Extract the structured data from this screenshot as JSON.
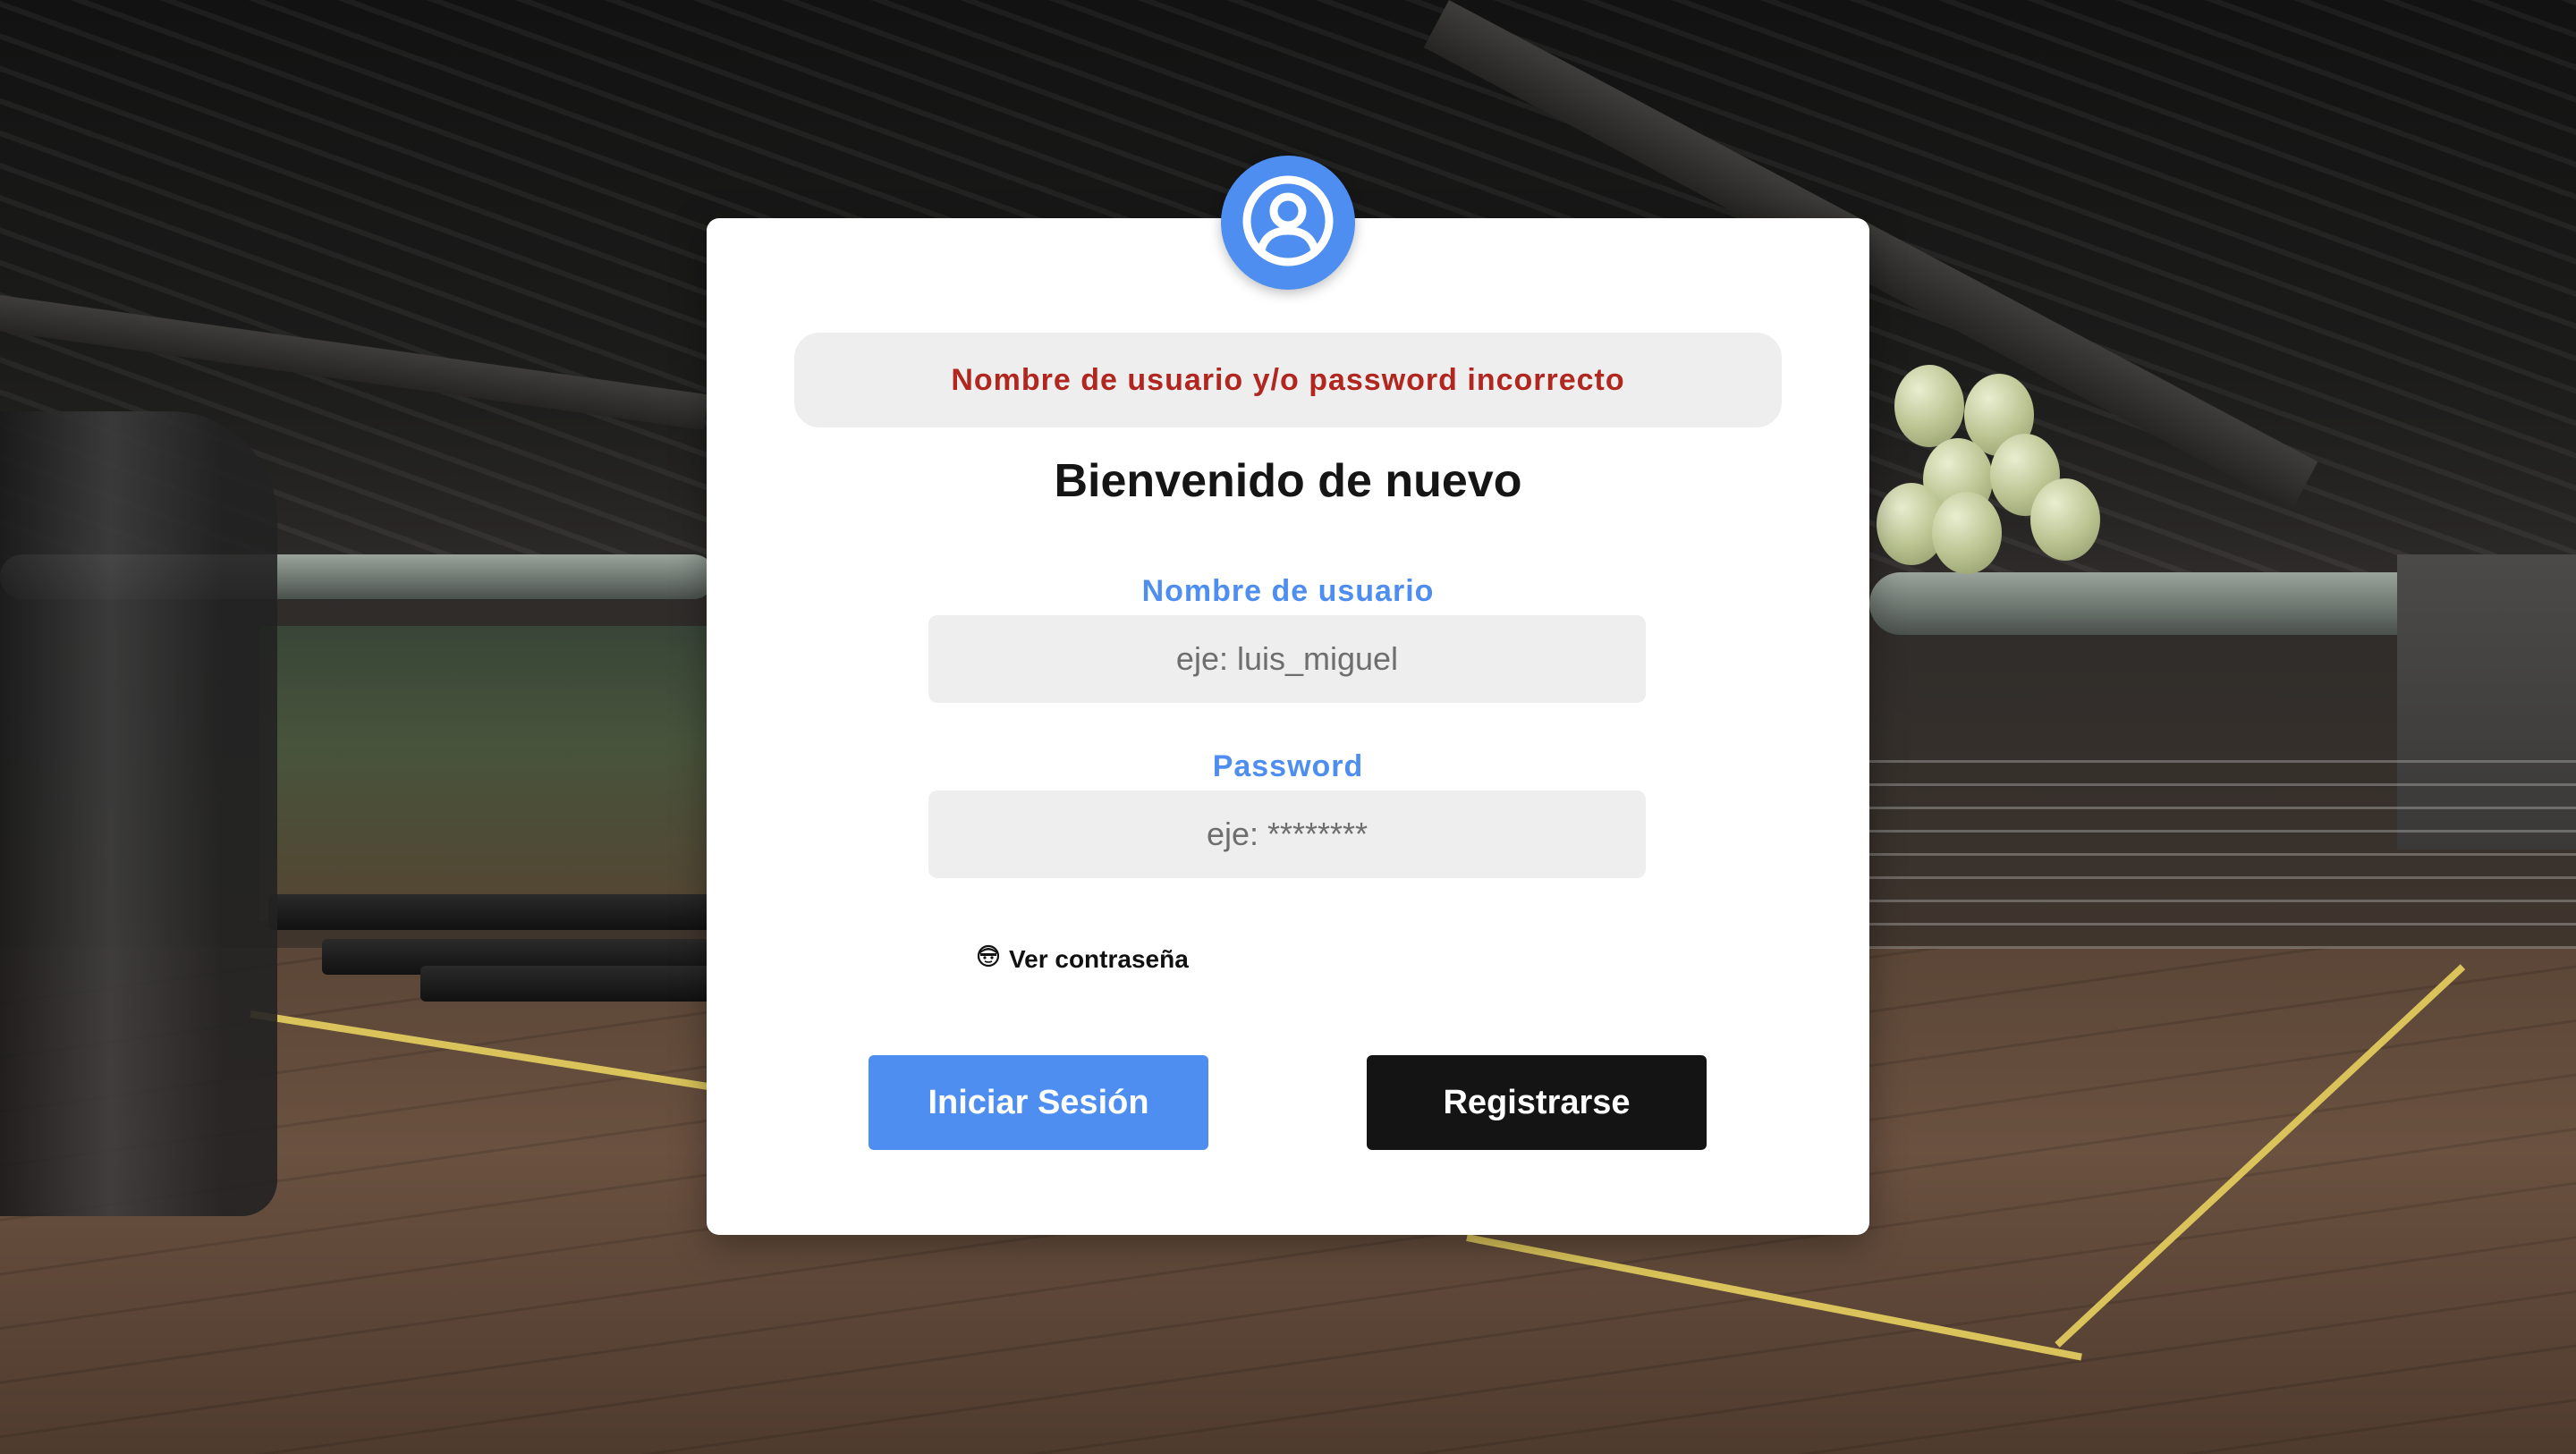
{
  "error_message": "Nombre de usuario y/o password incorrecto",
  "title": "Bienvenido de nuevo",
  "username": {
    "label": "Nombre de usuario",
    "placeholder": "eje: luis_miguel",
    "value": ""
  },
  "password": {
    "label": "Password",
    "placeholder": "eje: ********",
    "value": ""
  },
  "show_password": {
    "icon": "eye-face-icon",
    "label": "Ver contraseña"
  },
  "buttons": {
    "login": "Iniciar Sesión",
    "register": "Registrarse"
  },
  "colors": {
    "accent": "#4f8ef1",
    "error": "#b1261e",
    "dark_button": "#141414",
    "card": "#ffffff",
    "input_bg": "#eeeeee"
  },
  "avatar_icon": "user-circle-icon",
  "background": "gym-photo-background"
}
